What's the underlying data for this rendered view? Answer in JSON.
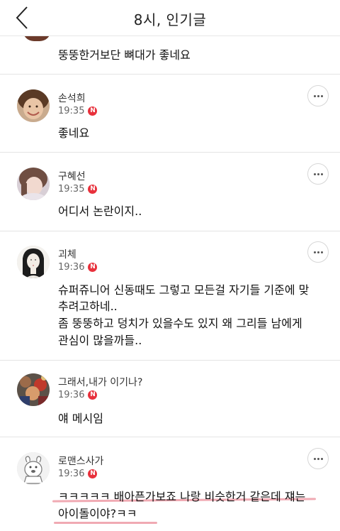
{
  "header": {
    "title": "8시, 인기글"
  },
  "first_comment": {
    "text": "뚱뚱한거보단 뼈대가 좋네요"
  },
  "badge_letter": "N",
  "comments": [
    {
      "author": "손석희",
      "time": "19:35",
      "text": [
        "좋네요"
      ]
    },
    {
      "author": "구혜선",
      "time": "19:35",
      "text": [
        "어디서 논란이지.."
      ]
    },
    {
      "author": "괴체",
      "time": "19:36",
      "text": [
        "슈퍼쥬니어 신동때도 그렇고 모든걸 자기들 기준에 맞",
        "추려고하네..",
        "좀 뚱뚱하고 덩치가 있을수도 있지 왜 그리들 남에게",
        "관심이 많을까들.."
      ]
    },
    {
      "author": "그래서,내가 이기나?",
      "time": "19:36",
      "text": [
        "얘 메시임"
      ]
    },
    {
      "author": "로맨스사가",
      "time": "19:36",
      "text": [
        "ㅋㅋㅋㅋㅋ 배아픈가보죠 나랑 비슷한거 같은데 쟤는",
        "아이돌이야?ㅋㅋ"
      ]
    }
  ],
  "colors": {
    "new_badge": "#e8313c",
    "highlight": "#f0aab3",
    "divider": "#e4e4e4"
  }
}
